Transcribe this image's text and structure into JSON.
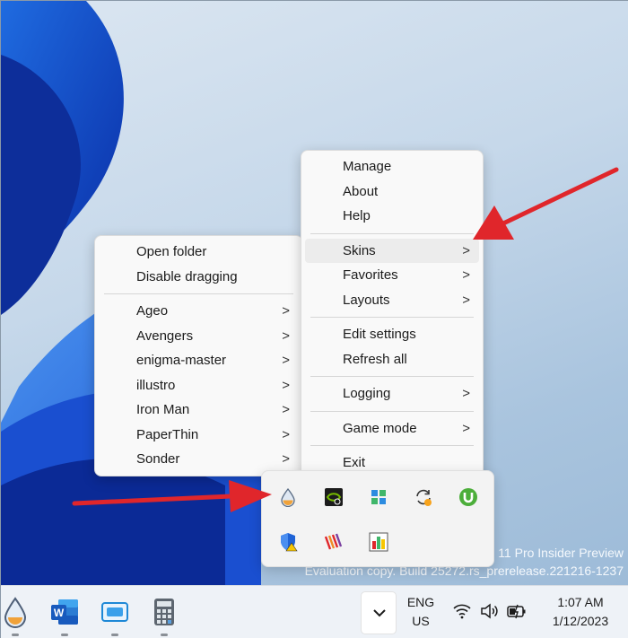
{
  "watermark": {
    "line1": "11 Pro Insider Preview",
    "line2": "Evaluation copy. Build 25272.rs_prerelease.221216-1237"
  },
  "main_menu": {
    "items": [
      {
        "label": "Manage"
      },
      {
        "label": "About"
      },
      {
        "label": "Help"
      },
      {
        "label": "Skins",
        "submenu": true
      },
      {
        "label": "Favorites",
        "submenu": true
      },
      {
        "label": "Layouts",
        "submenu": true
      },
      {
        "label": "Edit settings"
      },
      {
        "label": "Refresh all"
      },
      {
        "label": "Logging",
        "submenu": true
      },
      {
        "label": "Game mode",
        "submenu": true
      },
      {
        "label": "Exit"
      }
    ],
    "chevron": ">"
  },
  "skins_menu": {
    "items": [
      {
        "label": "Open folder"
      },
      {
        "label": "Disable dragging"
      },
      {
        "label": "Ageo",
        "submenu": true
      },
      {
        "label": "Avengers",
        "submenu": true
      },
      {
        "label": "enigma-master",
        "submenu": true
      },
      {
        "label": "illustro",
        "submenu": true
      },
      {
        "label": "Iron Man",
        "submenu": true
      },
      {
        "label": "PaperThin",
        "submenu": true
      },
      {
        "label": "Sonder",
        "submenu": true
      }
    ]
  },
  "tray_icons": [
    "rainmeter-icon",
    "nvidia-icon",
    "app-grid-icon",
    "sync-icon",
    "utorrent-icon",
    "windows-security-icon",
    "stripes-app-icon",
    "chart-app-icon"
  ],
  "taskbar": {
    "apps": [
      "rainmeter-icon",
      "word-icon",
      "remote-desktop-icon",
      "calculator-icon"
    ],
    "language": {
      "line1": "ENG",
      "line2": "US"
    },
    "clock": {
      "time": "1:07 AM",
      "date": "1/12/2023"
    }
  },
  "colors": {
    "arrow": "#e0262b",
    "menu_hover": "#ececec",
    "word_blue": "#185abd"
  }
}
